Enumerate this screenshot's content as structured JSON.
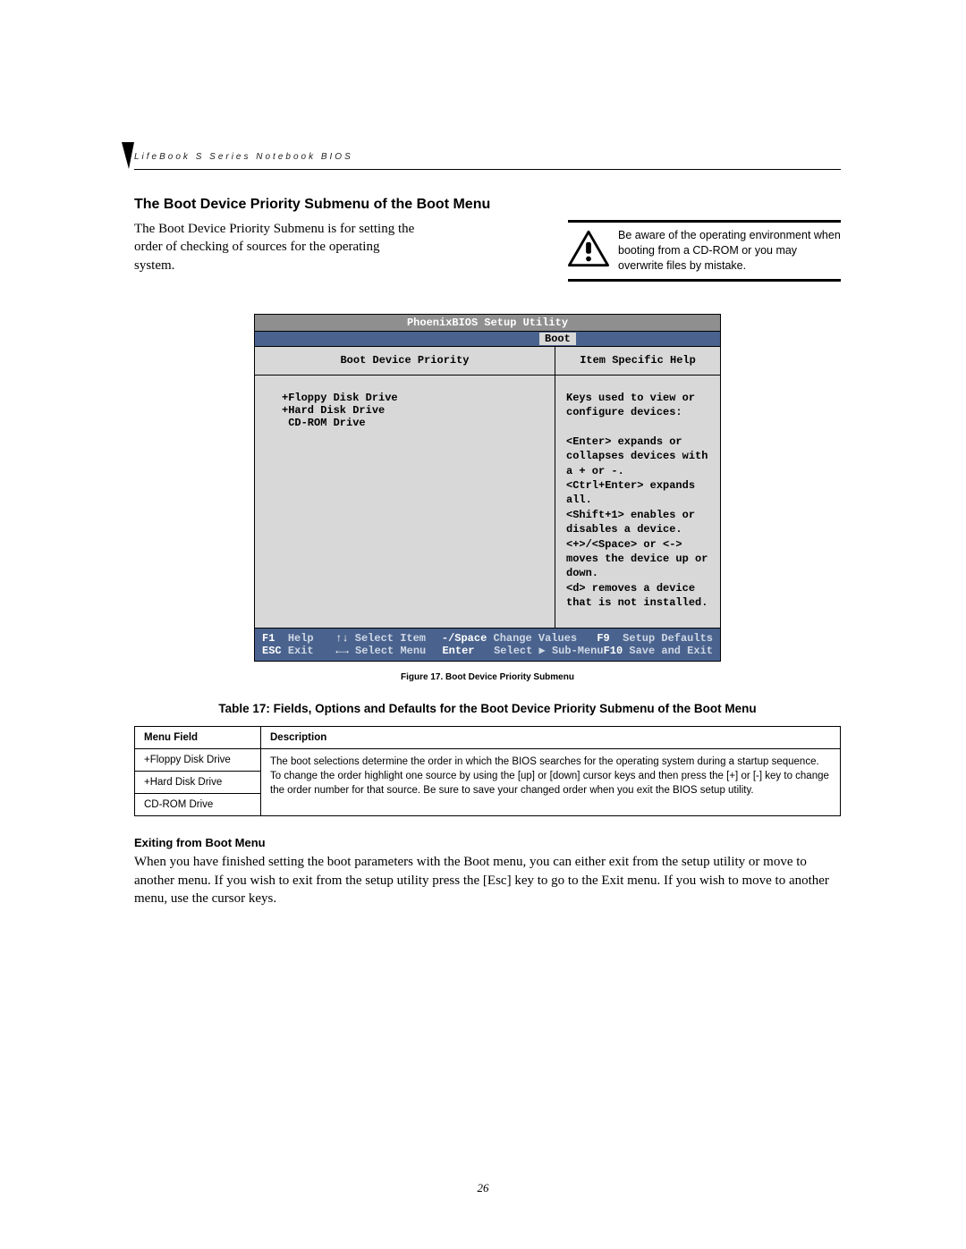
{
  "running_head": "LifeBook S Series Notebook BIOS",
  "section_title": "The Boot Device Priority Submenu of the Boot Menu",
  "intro": "The Boot Device Priority Submenu is for setting the order of checking of sources for the operating system.",
  "warning": "Be aware of the operating environment when booting from a CD-ROM or you may overwrite files by mistake.",
  "bios": {
    "title": "PhoenixBIOS Setup Utility",
    "active_tab": "Boot",
    "left_title": "Boot Device Priority",
    "right_title": "Item Specific Help",
    "devices": "+Floppy Disk Drive\n+Hard Disk Drive\n CD-ROM Drive",
    "help_lines": [
      "Keys used to view or",
      "configure devices:",
      "",
      "<Enter> expands or",
      "collapses devices with",
      "a + or -.",
      "<Ctrl+Enter> expands",
      "all.",
      "<Shift+1> enables or",
      "disables a device.",
      "<+>/<Space> or <->",
      "moves the device up or",
      "down.",
      "<d> removes a device",
      "that is not installed."
    ],
    "footer": {
      "f1": "F1",
      "f1_l": "Help",
      "esc": "ESC",
      "esc_l": "Exit",
      "ud": "↑↓",
      "ud_l": "Select Item",
      "lr": "←→",
      "lr_l": "Select Menu",
      "ms": "-/Space",
      "ms_l": "Change Values",
      "ent": "Enter",
      "ent_l": "Select ▶ Sub-Menu",
      "f9": "F9",
      "f9_l": "Setup Defaults",
      "f10": "F10",
      "f10_l": "Save and Exit"
    }
  },
  "figure_caption": "Figure 17.   Boot Device Priority Submenu",
  "table_title": "Table 17: Fields, Options and Defaults for the Boot Device Priority Submenu of the Boot Menu",
  "table": {
    "head_menu": "Menu Field",
    "head_desc": "Description",
    "rows": [
      "+Floppy Disk Drive",
      "+Hard Disk Drive",
      "CD-ROM Drive"
    ],
    "description": "The boot selections determine the order in which the BIOS searches for the operating system during a startup sequence. To change the order highlight one source by using the [up] or [down] cursor keys and then press the [+] or [-] key to change the order number for that source. Be sure to save your changed order when you exit the BIOS setup utility."
  },
  "exit_title": "Exiting from Boot Menu",
  "exit_body": "When you have finished setting the boot parameters with the Boot menu, you can either exit from the setup utility or move to another menu. If you wish to exit from the setup utility press the [Esc] key to go to the Exit menu. If you wish to move to another menu, use the cursor keys.",
  "page_number": "26"
}
